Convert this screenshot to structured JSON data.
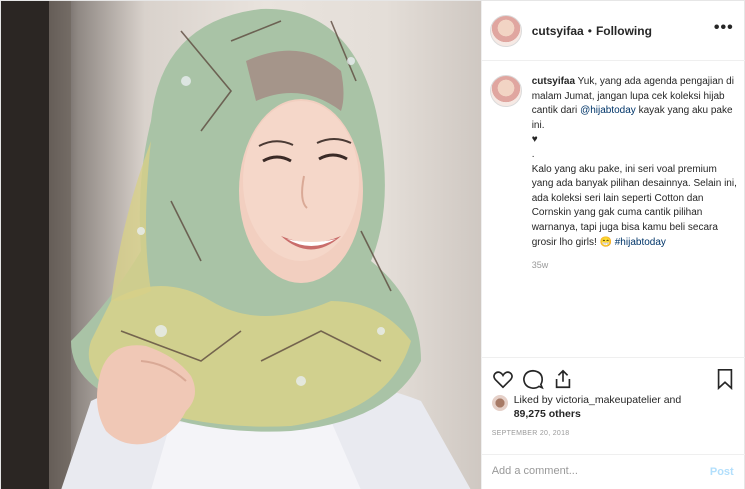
{
  "post": {
    "username": "cutsyifaa",
    "separator": "•",
    "follow_status": "Following",
    "more_label": "•••",
    "caption": {
      "username": "cutsyifaa",
      "line1": "Yuk, yang ada agenda pengajian di malam Jumat, jangan lupa cek koleksi hijab cantik dari",
      "mention": "@hijabtoday",
      "line1_end": "kayak yang aku pake ini.",
      "heart": "♥",
      "dot": ".",
      "paragraph2_start": "Kalo yang aku pake, ini seri voal premium yang ada banyak pilihan desainnya. Selain ini, ada koleksi seri lain seperti Cotton dan Cornskin yang gak cuma cantik pilihan warnanya, tapi juga bisa kamu beli secara grosir lho girls!",
      "emoji": "😁",
      "hashtag": "#hijabtoday",
      "time": "35w"
    },
    "icons": {
      "like": "heart-outline-icon",
      "comment": "comment-bubble-icon",
      "share": "share-icon",
      "save": "bookmark-icon"
    },
    "likes": {
      "prefix": "Liked by",
      "liker": "victoria_makeupatelier",
      "and": "and",
      "count": "89,275 others"
    },
    "date": "SEPTEMBER 20, 2018",
    "comment": {
      "placeholder": "Add a comment...",
      "post_label": "Post"
    }
  }
}
